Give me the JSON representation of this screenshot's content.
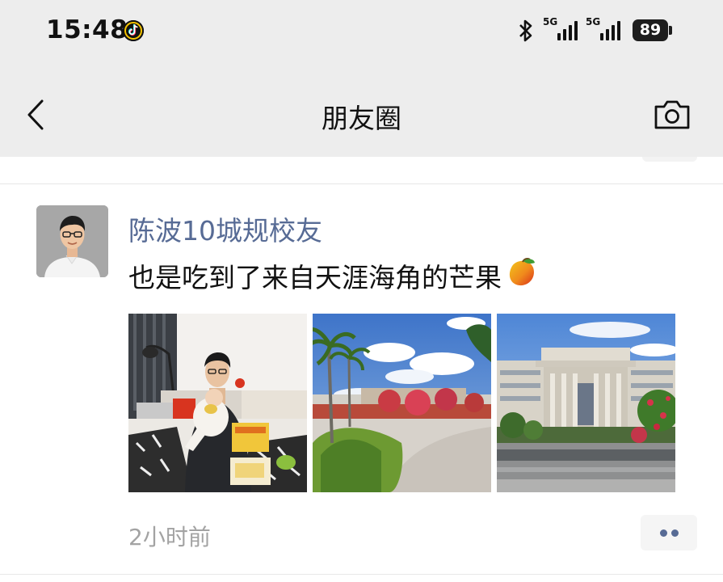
{
  "status_bar": {
    "time": "15:48",
    "signal_1_label": "5G",
    "signal_2_label": "5G",
    "battery": "89",
    "icons": [
      "tiktok-icon",
      "bluetooth-icon",
      "signal-icon",
      "signal-icon",
      "battery-icon"
    ]
  },
  "nav": {
    "title": "朋友圈",
    "back_icon": "chevron-left-icon",
    "camera_icon": "camera-icon"
  },
  "post": {
    "username": "陈波10城规校友",
    "text": "也是吃到了来自天涯海角的芒果",
    "emoji_icon": "mango-icon",
    "photos": [
      "photo-person-with-baby",
      "photo-palm-trees-campus",
      "photo-university-building"
    ],
    "time_ago": "2小时前",
    "more_icon": "more-dots-icon"
  },
  "colors": {
    "link_blue": "#576b95",
    "nav_bg": "#ededed",
    "muted_text": "#a3a3a3"
  }
}
